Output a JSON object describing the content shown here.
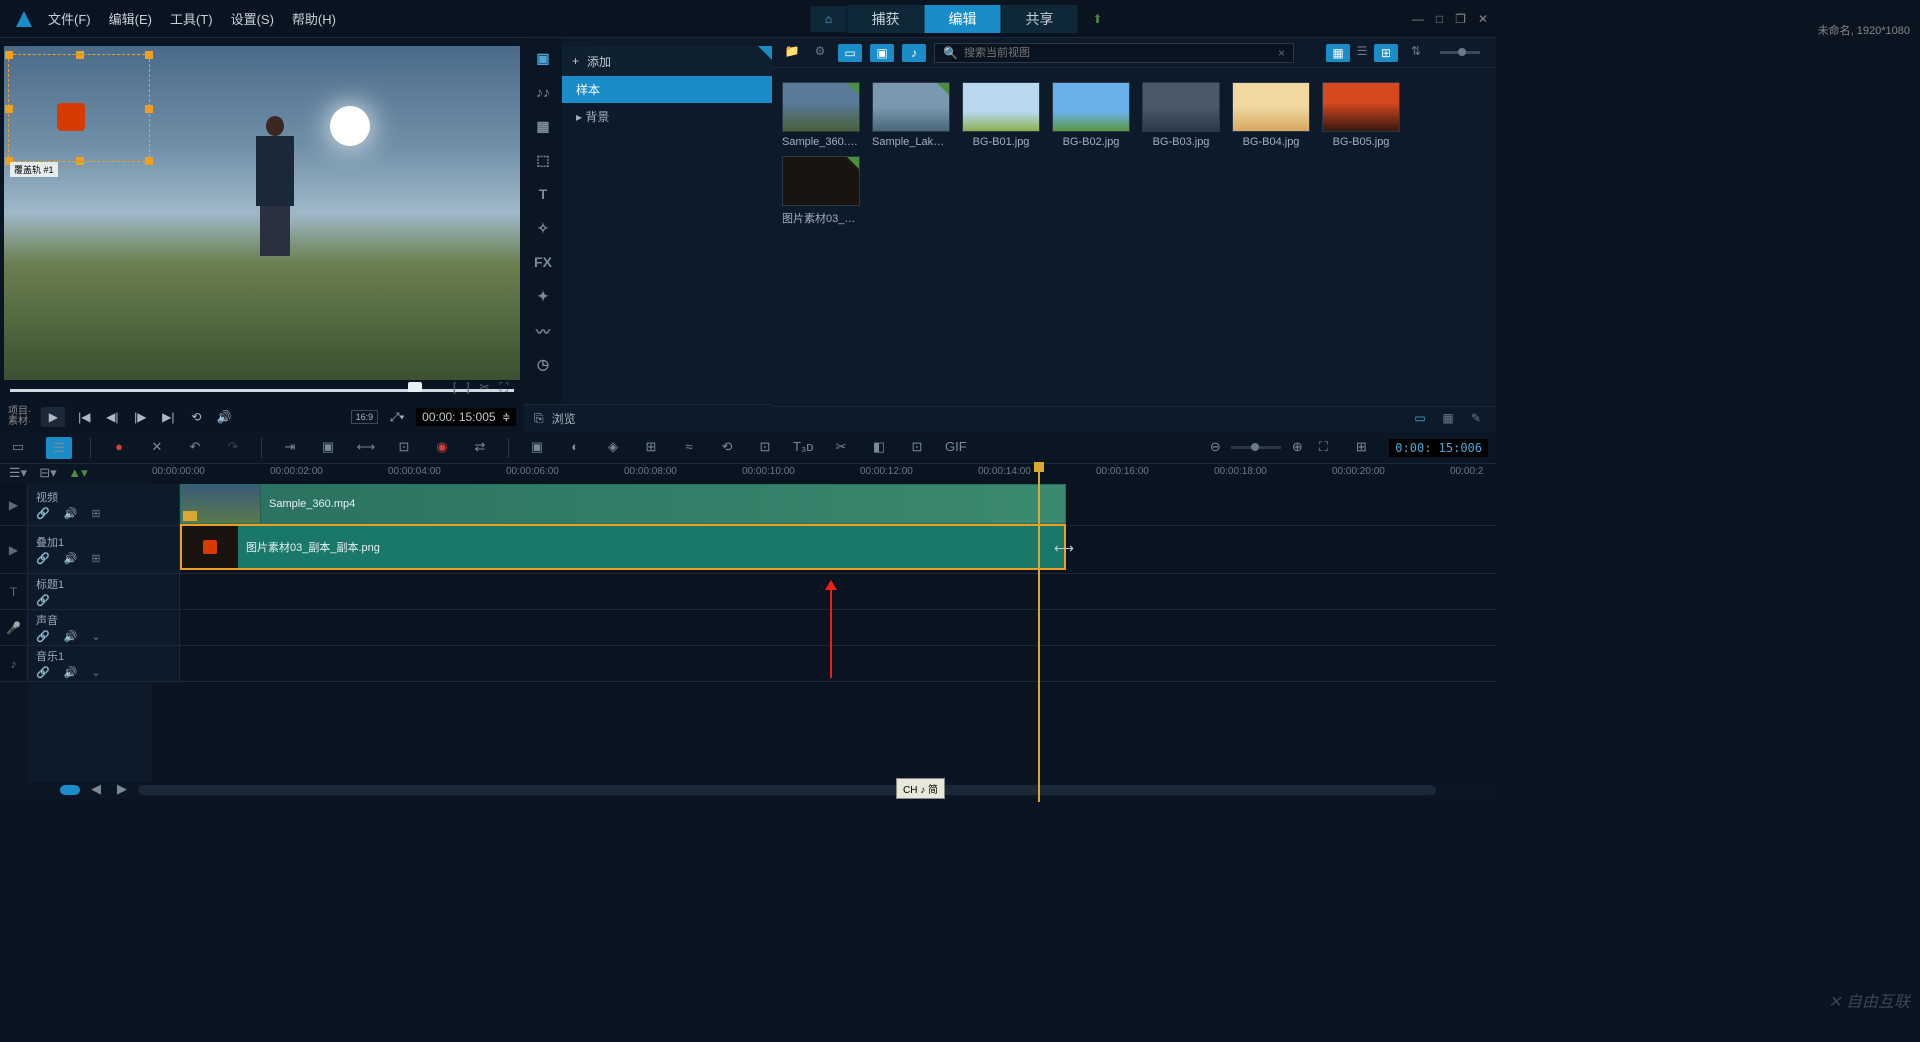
{
  "menu": {
    "file": "文件(F)",
    "edit": "编辑(E)",
    "tools": "工具(T)",
    "settings": "设置(S)",
    "help": "帮助(H)"
  },
  "tabs": {
    "capture": "捕获",
    "edit": "编辑",
    "share": "共享"
  },
  "project_info": "未命名, 1920*1080",
  "preview": {
    "overlay_badge": "覆盖轨 #1",
    "proj_label_1": "项目·",
    "proj_label_2": "素材·",
    "timecode": "00:00: 15:005",
    "aspect": "16:9"
  },
  "tree": {
    "add": "添加",
    "sample": "样本",
    "background": "背景",
    "browse": "浏览"
  },
  "search": {
    "placeholder": "搜索当前视图",
    "clear": "×"
  },
  "tool_strip": {
    "t": "T",
    "fx": "FX"
  },
  "library": [
    {
      "name": "Sample_360.m...",
      "bg": "linear-gradient(to bottom,#5a7a9a 40%,#4a6038 100%)",
      "checked": true
    },
    {
      "name": "Sample_Lake....",
      "bg": "linear-gradient(to bottom,#7a98b0 50%,#4a6878 100%)",
      "checked": true
    },
    {
      "name": "BG-B01.jpg",
      "bg": "linear-gradient(to bottom,#b8d8f0 60%,#8ab050 100%)",
      "checked": false
    },
    {
      "name": "BG-B02.jpg",
      "bg": "linear-gradient(to bottom,#6ab0e8 60%,#5a9840 100%)",
      "checked": false
    },
    {
      "name": "BG-B03.jpg",
      "bg": "linear-gradient(to bottom,#4a5868 50%,#2a3848 100%)",
      "checked": false
    },
    {
      "name": "BG-B04.jpg",
      "bg": "linear-gradient(to bottom,#f0d8a0 50%,#d8a860 100%)",
      "checked": false
    },
    {
      "name": "BG-B05.jpg",
      "bg": "linear-gradient(to bottom,#d84820 40%,#381810 100%)",
      "checked": false
    },
    {
      "name": "图片素材03_副...",
      "bg": "#1a1410",
      "checked": true
    }
  ],
  "timeline": {
    "timecode": "0:00: 15:006",
    "ticks": [
      "00:00:00:00",
      "00:00:02:00",
      "00:00:04:00",
      "00:00:06:00",
      "00:00:08:00",
      "00:00:10:00",
      "00:00:12:00",
      "00:00:14:00",
      "00:00:16:00",
      "00:00:18:00",
      "00:00:20:00",
      "00:00:2"
    ],
    "tracks": {
      "video": "视频",
      "overlay1": "叠加1",
      "title1": "标题1",
      "voice": "声音",
      "music1": "音乐1"
    },
    "clip_video": "Sample_360.mp4",
    "clip_overlay": "图片素材03_副本_副本.png",
    "tooltip": "CH ♪ 简",
    "track_t": "T"
  },
  "watermark": "自由互联"
}
